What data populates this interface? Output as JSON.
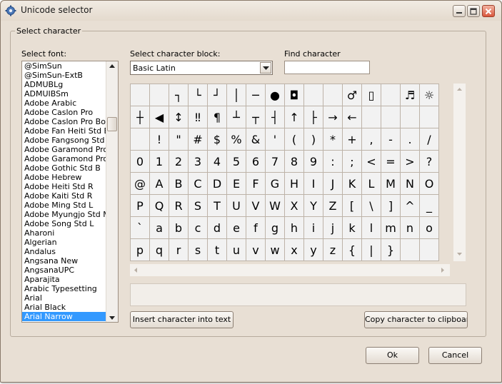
{
  "window": {
    "title": "Unicode selector"
  },
  "groupbox": {
    "title": "Select character"
  },
  "labels": {
    "select_font": "Select font:",
    "select_block": "Select character block:",
    "find_character": "Find character"
  },
  "font_list": {
    "items": [
      "@SimSun",
      "@SimSun-ExtB",
      "ADMUBLg",
      "ADMUIBSm",
      "Adobe Arabic",
      "Adobe Caslon Pro",
      "Adobe Caslon Pro Bold",
      "Adobe Fan Heiti Std B",
      "Adobe Fangsong Std R",
      "Adobe Garamond Pro",
      "Adobe Garamond Pro Bold",
      "Adobe Gothic Std B",
      "Adobe Hebrew",
      "Adobe Heiti Std R",
      "Adobe Kaiti Std R",
      "Adobe Ming Std L",
      "Adobe Myungjo Std M",
      "Adobe Song Std L",
      "Aharoni",
      "Algerian",
      "Andalus",
      "Angsana New",
      "AngsanaUPC",
      "Aparajita",
      "Arabic Typesetting",
      "Arial",
      "Arial Black",
      "Arial Narrow"
    ],
    "selected": "Arial Narrow"
  },
  "block_select": {
    "value": "Basic Latin"
  },
  "find_input": {
    "value": ""
  },
  "char_grid": {
    "cells": [
      "",
      "",
      "┐",
      "└",
      "┘",
      "│",
      "─",
      "●",
      "◘",
      "",
      "",
      "♂",
      "▯",
      "",
      "♬",
      "☼",
      "┼",
      "◀",
      "↕",
      "‼",
      "¶",
      "┴",
      "┬",
      "┤",
      "↑",
      "├",
      "→",
      "←",
      "",
      "",
      "",
      "",
      "",
      "!",
      "\"",
      "#",
      "$",
      "%",
      "&",
      "'",
      "(",
      ")",
      "*",
      "+",
      ",",
      "-",
      ".",
      "/",
      "0",
      "1",
      "2",
      "3",
      "4",
      "5",
      "6",
      "7",
      "8",
      "9",
      ":",
      ";",
      "<",
      "=",
      ">",
      "?",
      "@",
      "A",
      "B",
      "C",
      "D",
      "E",
      "F",
      "G",
      "H",
      "I",
      "J",
      "K",
      "L",
      "M",
      "N",
      "O",
      "P",
      "Q",
      "R",
      "S",
      "T",
      "U",
      "V",
      "W",
      "X",
      "Y",
      "Z",
      "[",
      "\\",
      "]",
      "^",
      "_",
      "`",
      "a",
      "b",
      "c",
      "d",
      "e",
      "f",
      "g",
      "h",
      "i",
      "j",
      "k",
      "l",
      "m",
      "n",
      "o",
      "p",
      "q",
      "r",
      "s",
      "t",
      "u",
      "v",
      "w",
      "x",
      "y",
      "z",
      "{",
      "|",
      "}",
      "",
      ""
    ]
  },
  "buttons": {
    "insert": "Insert character into text",
    "copy": "Copy character to clipboard",
    "ok": "Ok",
    "cancel": "Cancel"
  },
  "icons": {
    "app": "gear-icon",
    "minimize": "minimize-icon",
    "maximize": "maximize-icon",
    "close": "close-icon"
  },
  "colors": {
    "selection": "#3399ff",
    "window_bg": "#e8dfd4"
  }
}
